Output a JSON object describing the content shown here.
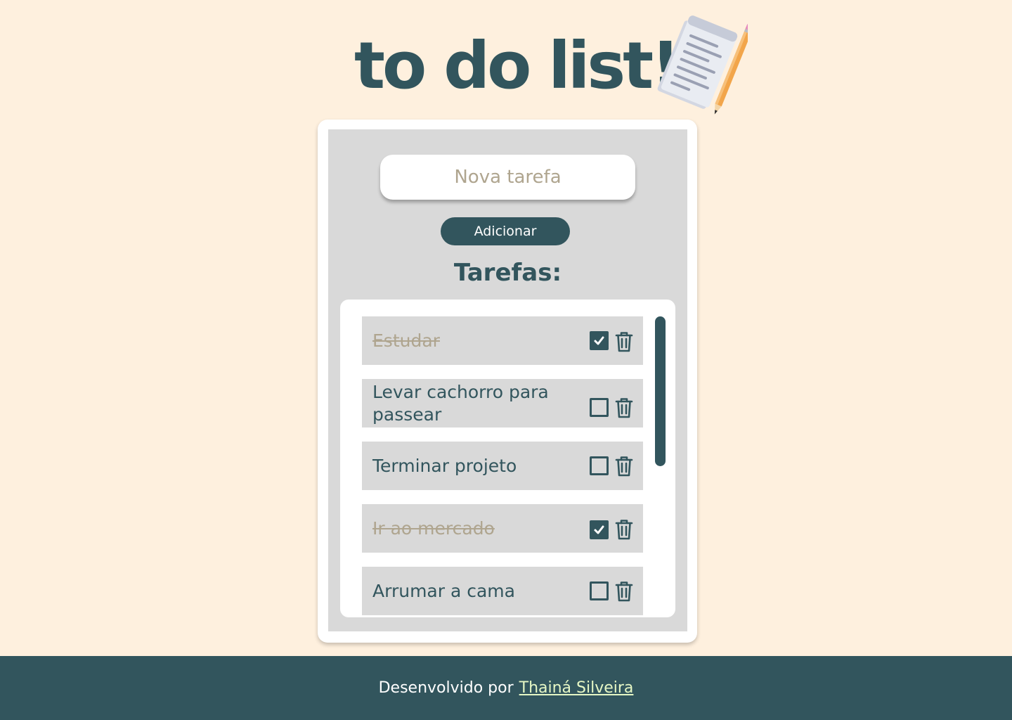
{
  "header": {
    "title": "to do list!",
    "icon": "notepad-pencil-icon"
  },
  "form": {
    "input_placeholder": "Nova tarefa",
    "input_value": "",
    "add_label": "Adicionar"
  },
  "list": {
    "heading": "Tarefas:",
    "tasks": [
      {
        "text": "Estudar",
        "done": true
      },
      {
        "text": "Levar cachorro para passear",
        "done": false
      },
      {
        "text": "Terminar projeto",
        "done": false
      },
      {
        "text": "Ir ao mercado",
        "done": true
      },
      {
        "text": "Arrumar a cama",
        "done": false
      }
    ]
  },
  "footer": {
    "prefix": "Desenvolvido por",
    "author": "Thainá Silveira"
  },
  "colors": {
    "background": "#FEF0DE",
    "primary": "#32555D",
    "panel": "#D9D9D9",
    "done_text": "#AFA58F",
    "link": "#E6F7C5"
  }
}
